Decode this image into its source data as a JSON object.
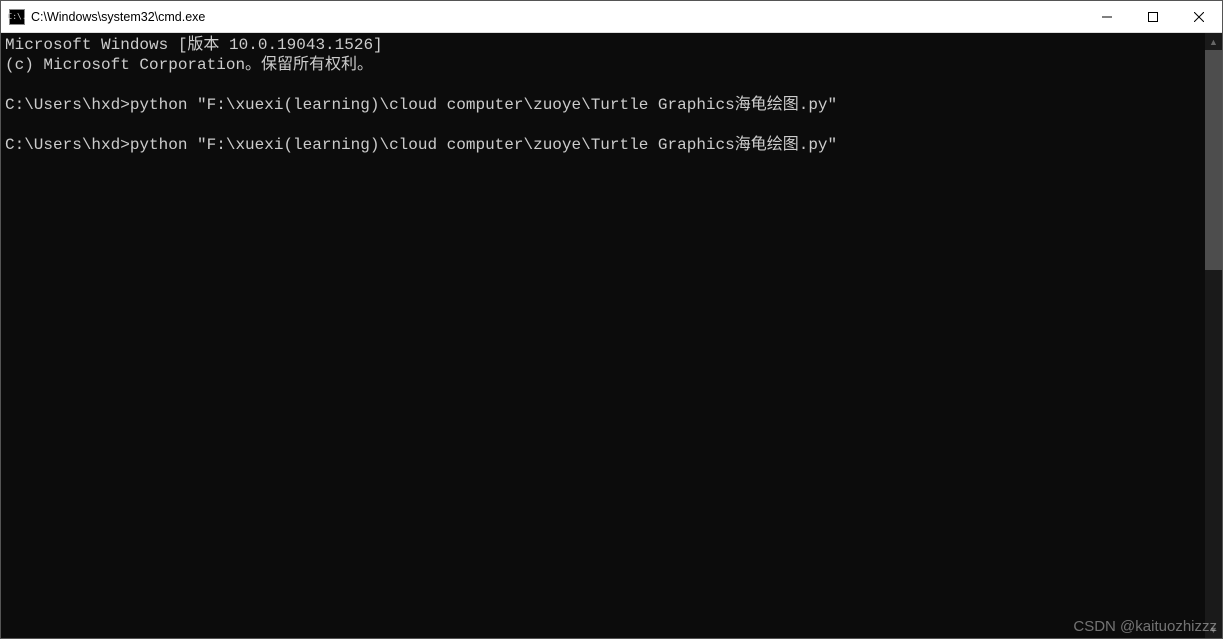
{
  "titlebar": {
    "icon_label": "C:\\.",
    "title": "C:\\Windows\\system32\\cmd.exe"
  },
  "terminal": {
    "line1": "Microsoft Windows [版本 10.0.19043.1526]",
    "line2": "(c) Microsoft Corporation。保留所有权利。",
    "blank1": "",
    "line3": "C:\\Users\\hxd>python \"F:\\xuexi(learning)\\cloud computer\\zuoye\\Turtle Graphics海龟绘图.py\"",
    "blank2": "",
    "line4": "C:\\Users\\hxd>python \"F:\\xuexi(learning)\\cloud computer\\zuoye\\Turtle Graphics海龟绘图.py\""
  },
  "watermark": "CSDN @kaituozhizzz"
}
